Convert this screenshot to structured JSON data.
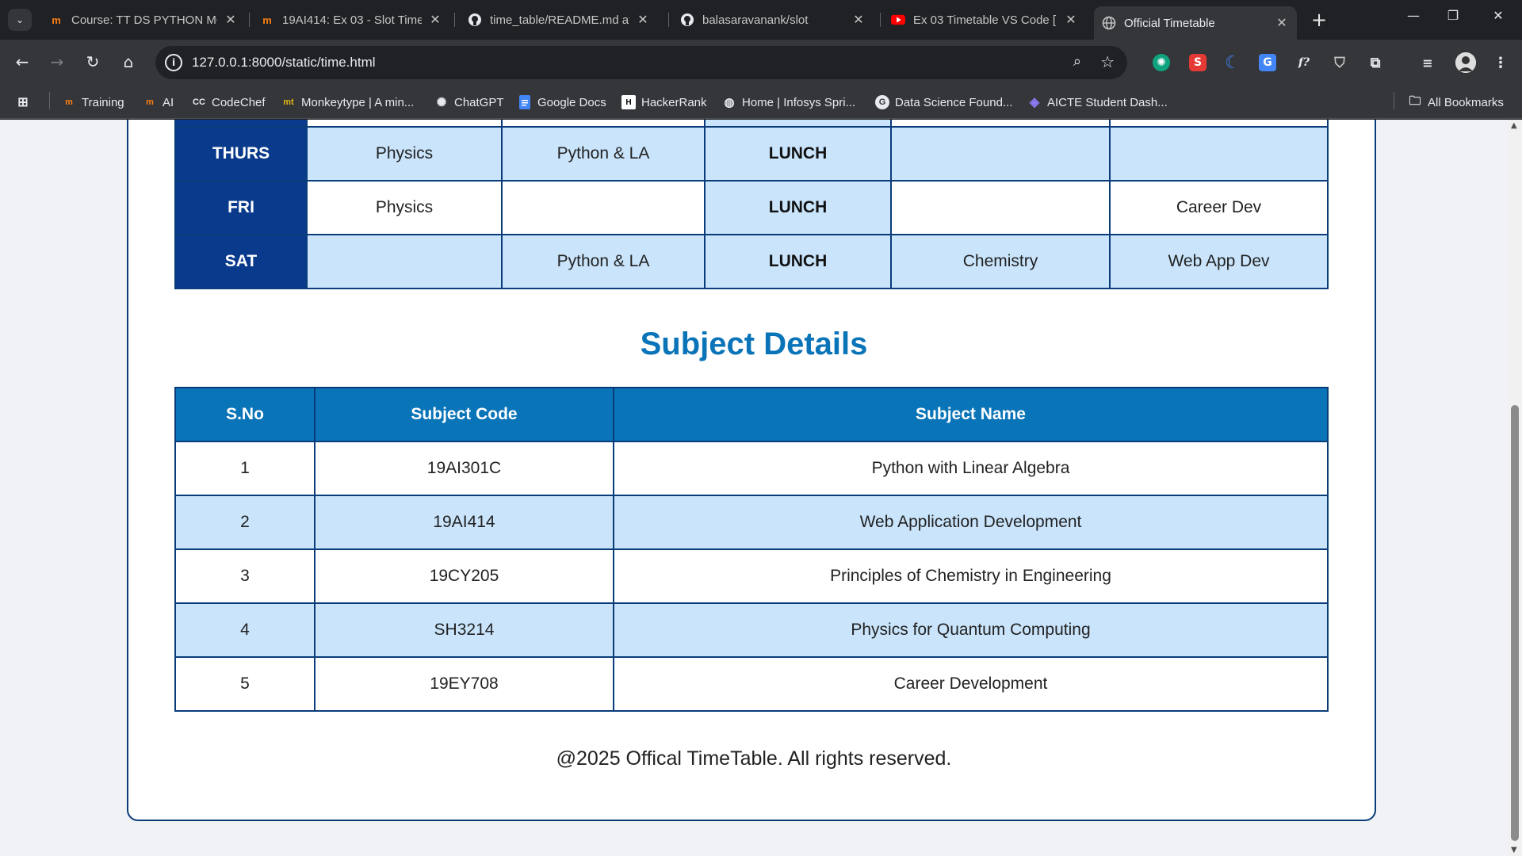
{
  "browser": {
    "tabs": [
      {
        "title": "Course: TT DS PYTHON MO",
        "favicon": "moodle-icon"
      },
      {
        "title": "19AI414: Ex 03 - Slot Time",
        "favicon": "moodle-icon"
      },
      {
        "title": "time_table/README.md at",
        "favicon": "github-icon"
      },
      {
        "title": "balasaravanank/slot",
        "favicon": "github-icon"
      },
      {
        "title": "Ex 03 Timetable VS Code [",
        "favicon": "youtube-icon"
      },
      {
        "title": "Official Timetable",
        "favicon": "globe-icon",
        "active": true
      }
    ],
    "url": "127.0.0.1:8000/static/time.html",
    "bookmarks": [
      {
        "label": "Training",
        "icon": "moodle-icon"
      },
      {
        "label": "AI",
        "icon": "moodle-icon"
      },
      {
        "label": "CodeChef",
        "icon": "codechef-icon"
      },
      {
        "label": "Monkeytype | A min...",
        "icon": "monkeytype-icon"
      },
      {
        "label": "ChatGPT",
        "icon": "chatgpt-icon"
      },
      {
        "label": "Google Docs",
        "icon": "docs-icon"
      },
      {
        "label": "HackerRank",
        "icon": "hackerrank-icon"
      },
      {
        "label": "Home | Infosys Spri...",
        "icon": "infosys-icon"
      },
      {
        "label": "Data Science Found...",
        "icon": "google-icon"
      },
      {
        "label": "AICTE Student Dash...",
        "icon": "aicte-icon"
      }
    ],
    "all_bookmarks": "All Bookmarks"
  },
  "timetable": {
    "rows": [
      {
        "day": "THURS",
        "cells": [
          "Physics",
          "Python & LA",
          "LUNCH",
          "",
          ""
        ]
      },
      {
        "day": "FRI",
        "cells": [
          "Physics",
          "",
          "LUNCH",
          "",
          "Career Dev"
        ]
      },
      {
        "day": "SAT",
        "cells": [
          "",
          "Python & LA",
          "LUNCH",
          "Chemistry",
          "Web App Dev"
        ]
      }
    ]
  },
  "subject_details": {
    "title": "Subject Details",
    "headers": [
      "S.No",
      "Subject Code",
      "Subject Name"
    ],
    "rows": [
      [
        "1",
        "19AI301C",
        "Python with Linear Algebra"
      ],
      [
        "2",
        "19AI414",
        "Web Application Development"
      ],
      [
        "3",
        "19CY205",
        "Principles of Chemistry in Engineering"
      ],
      [
        "4",
        "SH3214",
        "Physics for Quantum Computing"
      ],
      [
        "5",
        "19EY708",
        "Career Development"
      ]
    ]
  },
  "footer": "@2025 Offical TimeTable. All rights reserved."
}
